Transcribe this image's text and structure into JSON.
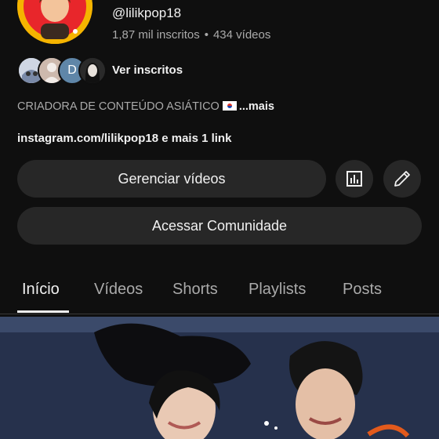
{
  "channel": {
    "handle": "@lilikpop18",
    "subscribers": "1,87 mil inscritos",
    "separator": "•",
    "videos": "434 vídeos",
    "see_subscribers": "Ver inscritos",
    "subscriber_initial": "D",
    "description": "CRIADORA DE CONTEÚDO ASIÁTICO",
    "description_more": "...mais",
    "link_text": "instagram.com/lilikpop18 e mais 1 link",
    "flag": "south-korea-flag"
  },
  "buttons": {
    "manage_videos": "Gerenciar vídeos",
    "community": "Acessar Comunidade",
    "stats_icon": "bar-chart-icon",
    "edit_icon": "pencil-icon"
  },
  "tabs": [
    "Início",
    "Vídeos",
    "Shorts",
    "Playlists",
    "Posts"
  ],
  "active_tab": "Início",
  "colors": {
    "background": "#0f0f0f",
    "button": "#272727",
    "text_primary": "#f1f1f1",
    "text_secondary": "#aaaaaa",
    "avatar_accent": "#f5b400"
  }
}
